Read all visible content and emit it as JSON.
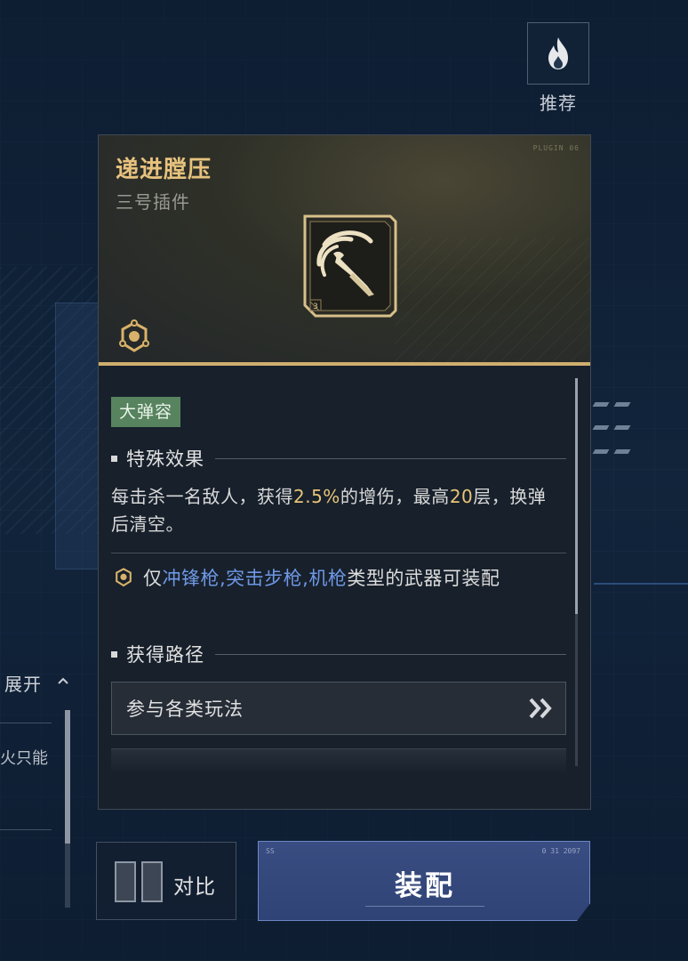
{
  "recommend": {
    "label": "推荐",
    "icon": "flame-icon"
  },
  "item": {
    "title": "递进膛压",
    "subtitle": "三号插件",
    "header_tag": "PLUGIN  06",
    "icon": "bullet-swirl-icon",
    "icon_level": "3"
  },
  "badge": {
    "label": "大弹容"
  },
  "special_effect": {
    "heading": "特殊效果",
    "text_part1": "每击杀一名敌人，获得",
    "value1": "2.5%",
    "text_part2": "的增伤，最高",
    "value2": "20",
    "text_part3": "层，换弹后清空。"
  },
  "restriction": {
    "prefix": "仅",
    "weapons": "冲锋枪,突击步枪,机枪",
    "suffix": "类型的武器可装配"
  },
  "acquire": {
    "heading": "获得路径",
    "source_label": "参与各类玩法"
  },
  "side_panel": {
    "expand_label": "展开",
    "partial_text": "火只能"
  },
  "buttons": {
    "compare_label": "对比",
    "equip_label": "装配",
    "equip_corner_left": "SS",
    "equip_corner_right": "0 31 2097"
  },
  "colors": {
    "title_gold": "#e7c27e",
    "highlight_gold": "#e8c477",
    "weapon_blue": "#6f98e6",
    "badge_green": "#57835f",
    "equip_blue": "#3a4d82"
  }
}
